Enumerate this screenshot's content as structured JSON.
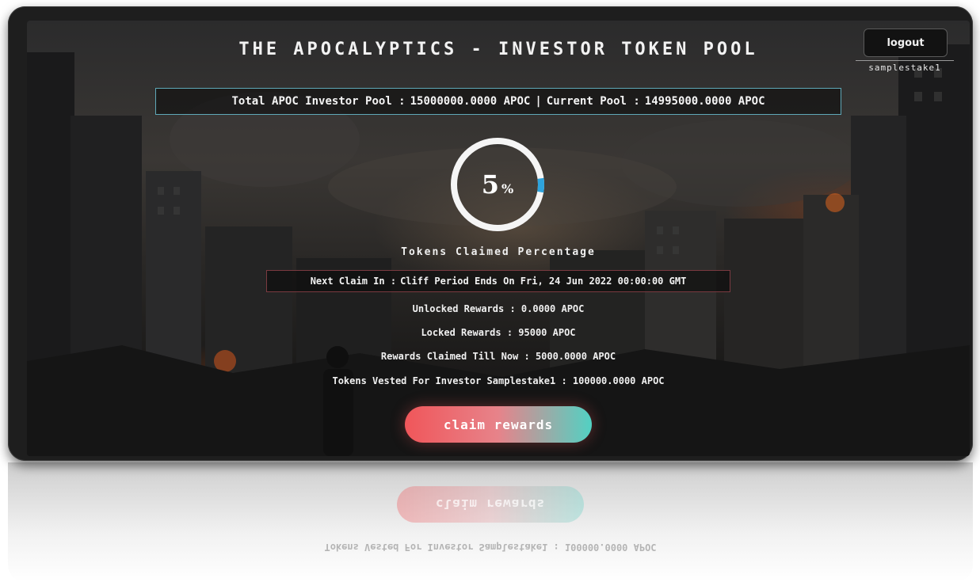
{
  "header": {
    "title": "THE APOCALYPTICS - INVESTOR TOKEN POOL",
    "logout_label": "logout",
    "username": "samplestake1"
  },
  "pool": {
    "total_label": "Total APOC Investor Pool :",
    "total_value": "15000000.0000 APOC",
    "separator": "|",
    "current_label": "Current Pool :",
    "current_value": "14995000.0000 APOC"
  },
  "progress": {
    "percent": 5,
    "value_text": "5",
    "unit": "%",
    "label": "Tokens Claimed Percentage"
  },
  "next_claim": {
    "label": "Next Claim In :",
    "value": "Cliff Period Ends On Fri, 24 Jun 2022 00:00:00 GMT"
  },
  "stats": {
    "unlocked": "Unlocked Rewards : 0.0000 APOC",
    "locked": "Locked Rewards : 95000 APOC",
    "claimed": "Rewards Claimed Till Now : 5000.0000 APOC",
    "vested": "Tokens Vested For Investor Samplestake1 : 100000.0000 APOC"
  },
  "actions": {
    "claim_label": "claim rewards"
  },
  "colors": {
    "ring_track": "#f5f5f5",
    "ring_progress": "#2ea3dc",
    "pool_border": "#5fa8b8",
    "next_border": "#7a3a40",
    "button_start": "#f0565a",
    "button_end": "#52d1c3"
  }
}
